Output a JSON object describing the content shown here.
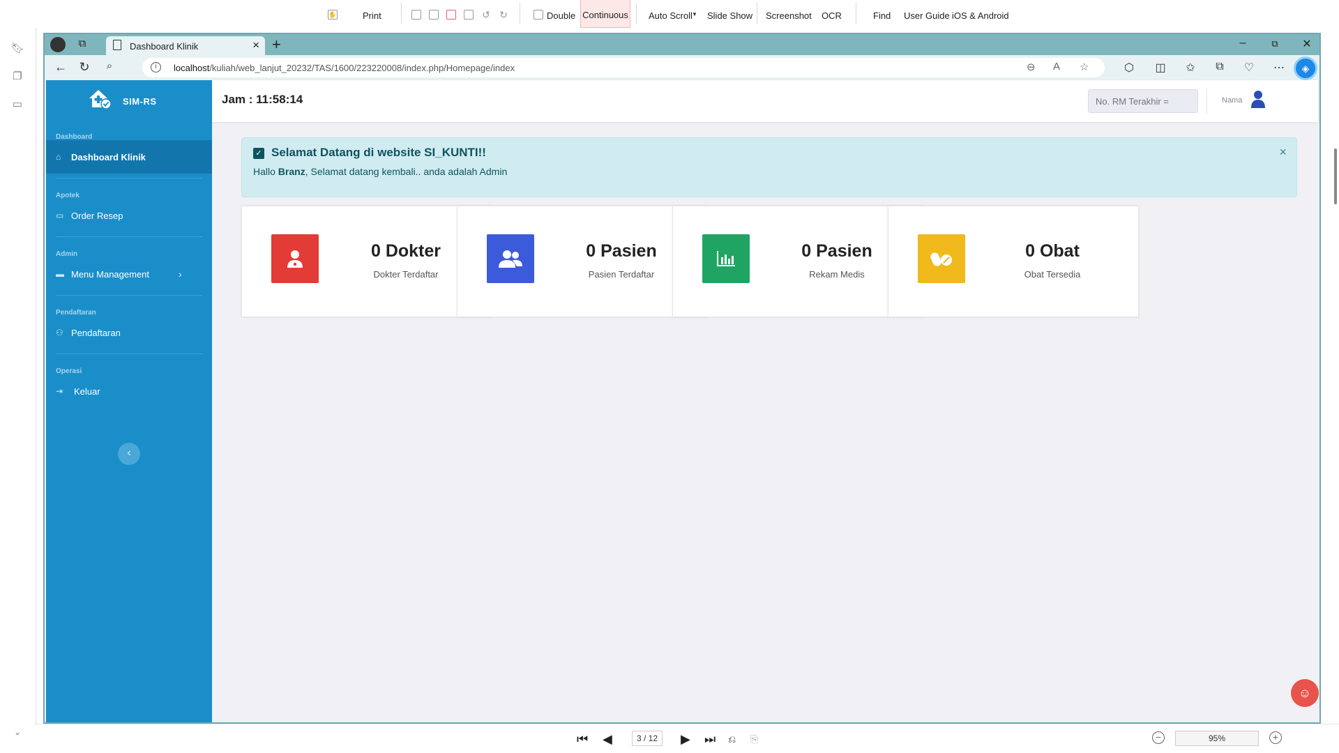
{
  "pdf_viewer": {
    "toolbar": {
      "print": "Print",
      "double": "Double",
      "continuous": "Continuous",
      "auto_scroll": "Auto Scroll",
      "slide_show": "Slide Show",
      "screenshot": "Screenshot",
      "ocr": "OCR",
      "find": "Find",
      "user_guide": "User Guide",
      "ios_android": "iOS & Android"
    },
    "page_indicator": "3 / 12",
    "zoom": "95%"
  },
  "browser": {
    "tab_title": "Dashboard Klinik",
    "url_host": "localhost",
    "url_path": "/kuliah/web_lanjut_20232/TAS/1600/223220008/index.php/Homepage/index"
  },
  "app": {
    "brand": "SIM-RS",
    "clock_label": "Jam : 11:58:14",
    "rm_placeholder": "No. RM Terakhir =",
    "user_name": "Nama",
    "sidebar": {
      "sections": [
        {
          "heading": "Dashboard",
          "item": "Dashboard Klinik"
        },
        {
          "heading": "Apotek",
          "item": "Order Resep"
        },
        {
          "heading": "Admin",
          "item": "Menu Management"
        },
        {
          "heading": "Pendaftaran",
          "item": "Pendaftaran"
        },
        {
          "heading": "Operasi",
          "item": "Keluar"
        }
      ]
    },
    "alert": {
      "title": "Selamat Datang di website SI_KUNTI!!",
      "msg_prefix": "Hallo ",
      "user": "Branz",
      "msg_suffix": ", Selamat datang kembali.. anda adalah Admin"
    },
    "cards": [
      {
        "value": "0 Dokter",
        "label": "Dokter Terdaftar",
        "color": "#e33b35"
      },
      {
        "value": "0 Pasien",
        "label": "Pasien Terdaftar",
        "color": "#3b5bdb"
      },
      {
        "value": "0 Pasien",
        "label": "Rekam Medis",
        "color": "#1fa463"
      },
      {
        "value": "0 Obat",
        "label": "Obat Tersedia",
        "color": "#f0b91c"
      }
    ]
  }
}
